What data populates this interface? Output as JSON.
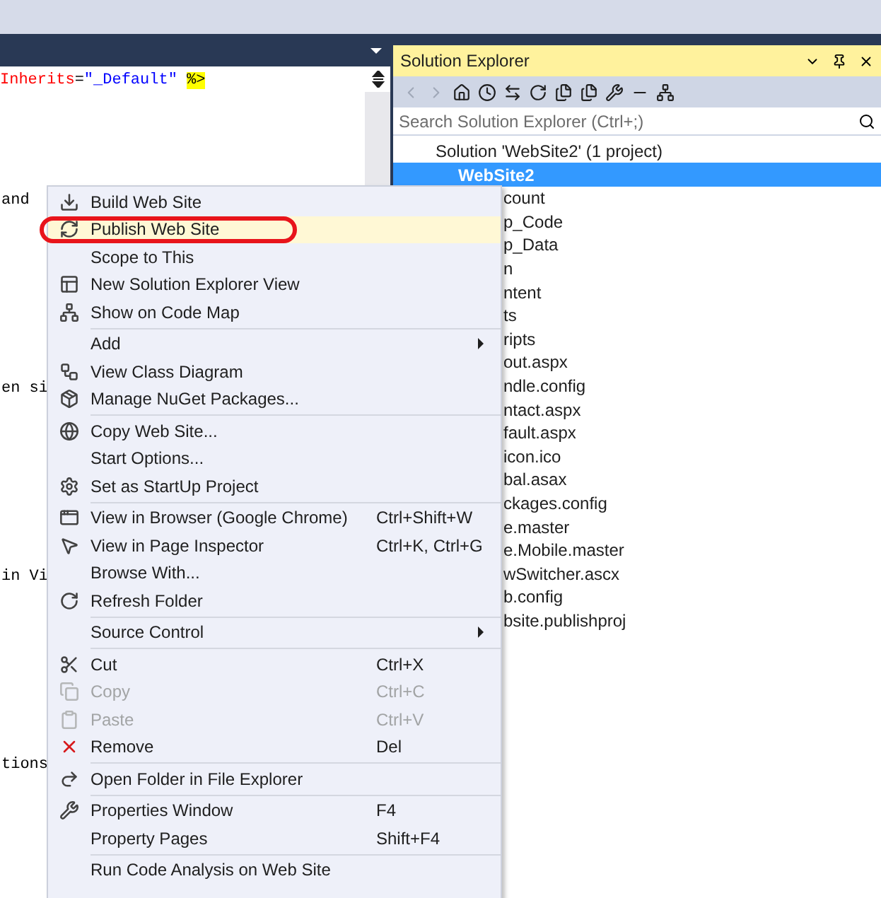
{
  "editor": {
    "code_line": [
      {
        "kind": "attr",
        "text": "Inherits"
      },
      {
        "kind": "plain",
        "text": "="
      },
      {
        "kind": "value",
        "text": "\"_Default\""
      },
      {
        "kind": "marker",
        "text": "%>"
      }
    ],
    "fragments": [
      "and",
      "en si",
      "in Vi",
      "tions"
    ]
  },
  "solution_explorer": {
    "title": "Solution Explorer",
    "search": {
      "placeholder": "Search Solution Explorer (Ctrl+;)"
    },
    "solution": "Solution 'WebSite2' (1 project)",
    "project": {
      "label": "WebSite2",
      "selected": true
    },
    "children": [
      "count",
      "p_Code",
      "p_Data",
      "n",
      "ntent",
      "ts",
      "ripts",
      "out.aspx",
      "ndle.config",
      "ntact.aspx",
      "fault.aspx",
      "icon.ico",
      "bal.asax",
      "ckages.config",
      "e.master",
      "e.Mobile.master",
      "wSwitcher.ascx",
      "b.config",
      "bsite.publishproj"
    ]
  },
  "context_menu": {
    "groups": [
      [
        {
          "kind": "build",
          "label": "Build Web Site",
          "highlighted": false,
          "disabled": false
        },
        {
          "kind": "publish",
          "label": "Publish Web Site",
          "highlighted": true,
          "disabled": false,
          "circled": true
        },
        {
          "kind": "plain",
          "label": "Scope to This",
          "highlighted": false,
          "disabled": false
        },
        {
          "kind": "view",
          "label": "New Solution Explorer View",
          "highlighted": false,
          "disabled": false
        },
        {
          "kind": "codemap",
          "label": "Show on Code Map",
          "highlighted": false,
          "disabled": false
        }
      ],
      [
        {
          "kind": "plain",
          "label": "Add",
          "highlighted": false,
          "disabled": false,
          "submenu": true
        },
        {
          "kind": "classdiagram",
          "label": "View Class Diagram",
          "highlighted": false,
          "disabled": false
        },
        {
          "kind": "nuget",
          "label": "Manage NuGet Packages...",
          "highlighted": false,
          "disabled": false
        }
      ],
      [
        {
          "kind": "globe",
          "label": "Copy Web Site...",
          "highlighted": false,
          "disabled": false
        },
        {
          "kind": "plain",
          "label": "Start Options...",
          "highlighted": false,
          "disabled": false
        },
        {
          "kind": "gear",
          "label": "Set as StartUp Project",
          "highlighted": false,
          "disabled": false
        }
      ],
      [
        {
          "kind": "browser",
          "label": "View in Browser (Google Chrome)",
          "shortcut": "Ctrl+Shift+W",
          "highlighted": false,
          "disabled": false
        },
        {
          "kind": "inspector",
          "label": "View in Page Inspector",
          "shortcut": "Ctrl+K, Ctrl+G",
          "highlighted": false,
          "disabled": false
        },
        {
          "kind": "plain",
          "label": "Browse With...",
          "highlighted": false,
          "disabled": false
        },
        {
          "kind": "refresh",
          "label": "Refresh Folder",
          "highlighted": false,
          "disabled": false
        }
      ],
      [
        {
          "kind": "plain",
          "label": "Source Control",
          "highlighted": false,
          "disabled": false,
          "submenu": true
        }
      ],
      [
        {
          "kind": "cut",
          "label": "Cut",
          "shortcut": "Ctrl+X",
          "highlighted": false,
          "disabled": false
        },
        {
          "kind": "copy",
          "label": "Copy",
          "shortcut": "Ctrl+C",
          "highlighted": false,
          "disabled": true
        },
        {
          "kind": "paste",
          "label": "Paste",
          "shortcut": "Ctrl+V",
          "highlighted": false,
          "disabled": true
        },
        {
          "kind": "remove",
          "label": "Remove",
          "shortcut": "Del",
          "highlighted": false,
          "disabled": false
        }
      ],
      [
        {
          "kind": "redo",
          "label": "Open Folder in File Explorer",
          "highlighted": false,
          "disabled": false
        }
      ],
      [
        {
          "kind": "wrench",
          "label": "Properties Window",
          "shortcut": "F4",
          "highlighted": false,
          "disabled": false
        },
        {
          "kind": "plain",
          "label": "Property Pages",
          "shortcut": "Shift+F4",
          "highlighted": false,
          "disabled": false
        }
      ],
      [
        {
          "kind": "plain",
          "label": "Run Code Analysis on Web Site",
          "highlighted": false,
          "disabled": false
        }
      ]
    ]
  }
}
